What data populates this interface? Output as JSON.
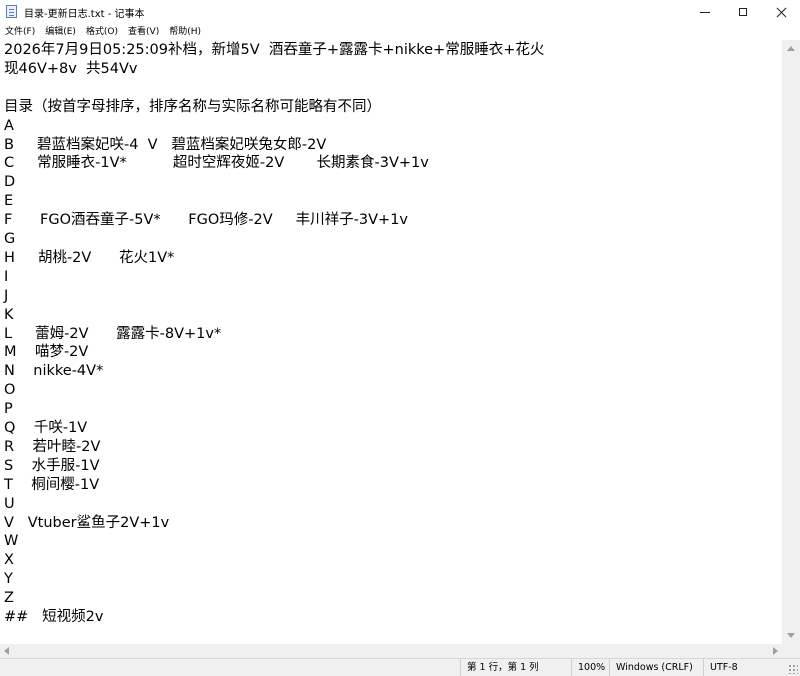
{
  "window": {
    "title": "目录-更新日志.txt - 记事本"
  },
  "menu": {
    "items": [
      "文件(F)",
      "编辑(E)",
      "格式(O)",
      "查看(V)",
      "帮助(H)"
    ]
  },
  "content": {
    "lines": [
      "2026年7月9日05:25:09补档，新增5V  酒吞童子+露露卡+nikke+常服睡衣+花火",
      "现46V+8v  共54Vv",
      "",
      "目录（按首字母排序，排序名称与实际名称可能略有不同）",
      "A",
      "B     碧蓝档案妃咲-4  V   碧蓝档案妃咲兔女郎-2V",
      "C     常服睡衣-1V*          超时空辉夜姬-2V       长期素食-3V+1v",
      "D",
      "E",
      "F      FGO酒吞童子-5V*      FGO玛修-2V     丰川祥子-3V+1v",
      "G",
      "H     胡桃-2V      花火1V*",
      "I",
      "J",
      "K",
      "L     蕾姆-2V      露露卡-8V+1v*",
      "M    喵梦-2V",
      "N    nikke-4V*",
      "O",
      "P",
      "Q    千咲-1V",
      "R    若叶睦-2V",
      "S    水手服-1V",
      "T    桐间樱-1V",
      "U",
      "V   Vtuber鲨鱼子2V+1v",
      "W",
      "X",
      "Y",
      "Z",
      "##   短视频2v"
    ]
  },
  "status": {
    "position": "第 1 行，第 1 列",
    "zoom": "100%",
    "line_ending": "Windows (CRLF)",
    "encoding": "UTF-8"
  }
}
